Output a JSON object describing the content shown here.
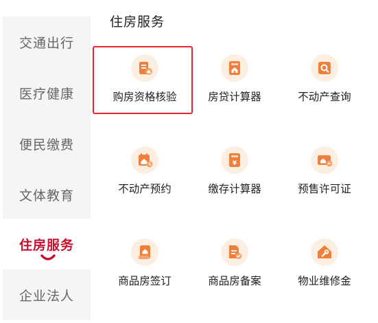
{
  "sidebar": {
    "items": [
      {
        "label": "交通出行"
      },
      {
        "label": "医疗健康"
      },
      {
        "label": "便民缴费"
      },
      {
        "label": "文体教育"
      },
      {
        "label": "住房服务",
        "active": true
      },
      {
        "label": "企业法人"
      }
    ]
  },
  "section": {
    "title": "住房服务"
  },
  "tiles": [
    {
      "label": "购房资格核验",
      "icon": "document-house-icon"
    },
    {
      "label": "房贷计算器",
      "icon": "house-calculator-icon"
    },
    {
      "label": "不动产查询",
      "icon": "search-icon"
    },
    {
      "label": "不动产预约",
      "icon": "calendar-house-icon"
    },
    {
      "label": "缴存计算器",
      "icon": "yuan-calculator-icon"
    },
    {
      "label": "预售许可证",
      "icon": "house-card-icon"
    },
    {
      "label": "商品房签订",
      "icon": "contract-house-icon"
    },
    {
      "label": "商品房备案",
      "icon": "file-record-icon"
    },
    {
      "label": "物业维修金",
      "icon": "wrench-house-icon"
    }
  ],
  "colors": {
    "accent": "#c8102e",
    "icon_orange": "#f07f3c",
    "icon_bg": "#fdeee2",
    "highlight_border": "#e3262e",
    "sidebar_bg": "#f5f5f5"
  }
}
